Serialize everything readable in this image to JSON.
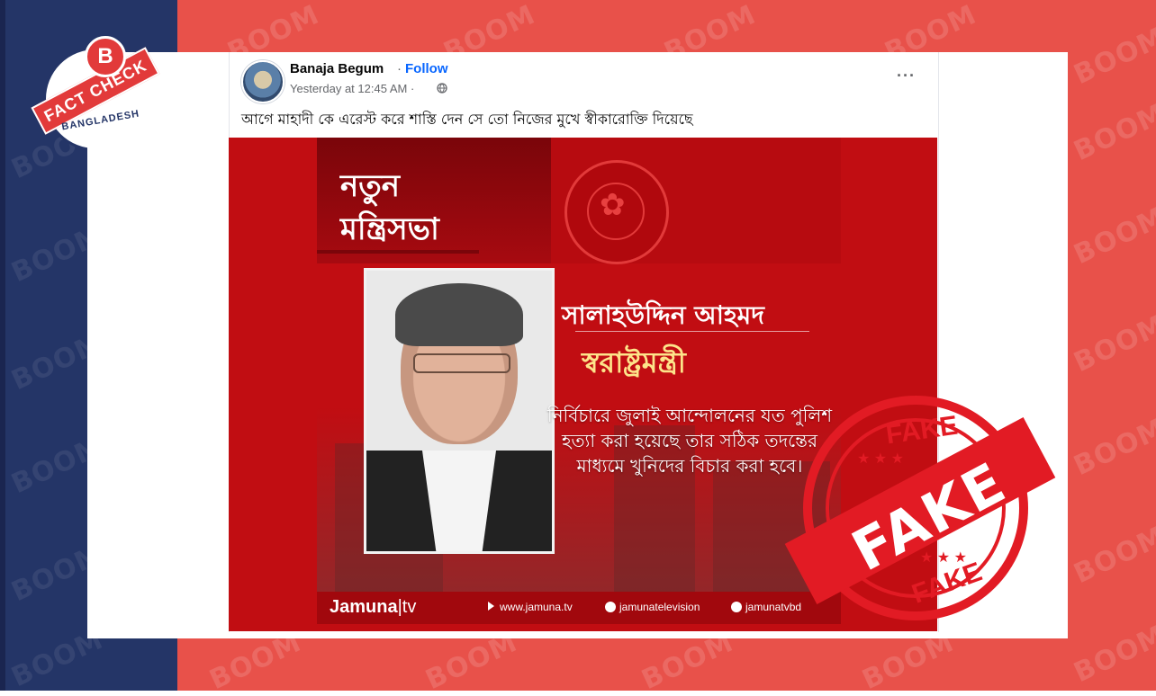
{
  "watermark": "BOOM",
  "logo": {
    "letter": "B",
    "banner": "FACT CHECK",
    "country": "BANGLADESH"
  },
  "post": {
    "author": "Banaja Begum",
    "separator": "·",
    "follow_label": "Follow",
    "timestamp": "Yesterday at 12:45 AM ·",
    "privacy_icon": "globe-icon",
    "more_label": "···",
    "caption": "আগে মাহাদী কে এরেস্ট করে শাস্তি দেন সে তো নিজের মুখে স্বীকারোক্তি দিয়েছে"
  },
  "image": {
    "title_line1": "নতুন",
    "title_line2": "মন্ত্রিসভা",
    "name": "সালাহউদ্দিন আহমদ",
    "role": "স্বরাষ্ট্রমন্ত্রী",
    "quote": "নির্বিচারে জুলাই আন্দোলনের যত পুলিশ হত্যা করা হয়েছে তার সঠিক তদন্তের মাধ্যমে খুনিদের বিচার করা হবে।",
    "footer_brand": "Jamuna",
    "footer_brand_tv": "|tv",
    "footer_web": "www.jamuna.tv",
    "footer_fb": "jamunatelevision",
    "footer_yt": "jamunatvbd"
  },
  "stamp": {
    "main": "FAKE",
    "top": "FAKE",
    "bottom": "FAKE",
    "color": "#e21b24"
  },
  "colors": {
    "background_red": "#e8514a",
    "background_navy": "#243567",
    "follow_blue": "#0866ff"
  }
}
